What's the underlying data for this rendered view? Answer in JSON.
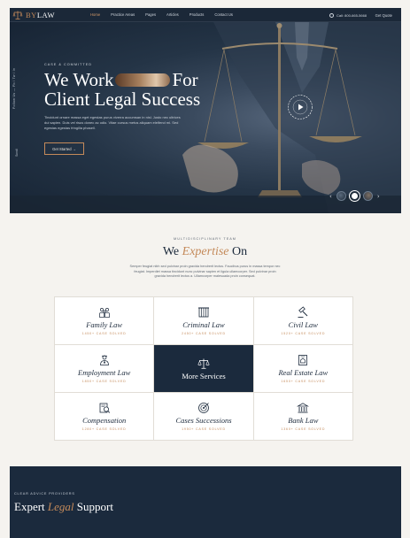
{
  "brand": {
    "logo_prefix": "BY",
    "logo_suffix": "LAW"
  },
  "nav": {
    "items": [
      "Home",
      "Practice Areas",
      "Pages",
      "Articles",
      "Products",
      "Contact Us"
    ],
    "active_index": 0,
    "call": "Call: 800-665-5668",
    "quote": "Get Quote"
  },
  "hero": {
    "side_text": "Follow Us — Fb / Tw / In",
    "scroll_text": "Scroll",
    "eyebrow": "CASE & COMMITTED",
    "title_line1_start": "We Work",
    "title_line1_end": "For",
    "title_line2": "Client Legal Success",
    "description": "Tincidunt ornare massa eget egestas purus viverra accumsan in nisl. Justo nec ultrices dui sapien. Duis vel risus donec ac odio. Vitae cursus metus aliquam eleifend mi. Sed egestas egestas fringilla phasell.",
    "cta": "Get Started →",
    "slider_prev": "‹",
    "slider_next": "›",
    "active_slide": 2,
    "slide_count": 3
  },
  "expertise": {
    "kicker": "MULTIDISCIPLINARY TEAM",
    "title_start": "We ",
    "title_accent": "Expertise",
    "title_end": " On",
    "description": "Semper feugiat nibh sed pulvinar proin gravida hendrerit lectus. Faucibus purus in massa tempor nec feugiat. Imperdiet massa tincidunt nunc pulvinar sapien et ligula ullamcorper. Sed pulvinar proin gravida hendrerit lectus a. Ullamcorper malesuada proin consequat.",
    "cards": [
      {
        "name": "Family Law",
        "count": "1450+ CASE SOLVED",
        "icon": "family-law-icon"
      },
      {
        "name": "Criminal Law",
        "count": "2450+ CASE SOLVED",
        "icon": "criminal-law-icon"
      },
      {
        "name": "Civil Law",
        "count": "1520+ CASE SOLVED",
        "icon": "civil-law-icon"
      },
      {
        "name": "Employment Law",
        "count": "1850+ CASE SOLVED",
        "icon": "employment-law-icon"
      },
      {
        "name": "More Services",
        "count": "",
        "icon": "scales-icon"
      },
      {
        "name": "Real Estate Law",
        "count": "1650+ CASE SOLVED",
        "icon": "real-estate-law-icon"
      },
      {
        "name": "Compensation",
        "count": "1280+ CASE SOLVED",
        "icon": "compensation-icon"
      },
      {
        "name": "Cases Successions",
        "count": "1950+ CASE SOLVED",
        "icon": "cases-successions-icon"
      },
      {
        "name": "Bank Law",
        "count": "1360+ CASE SOLVED",
        "icon": "bank-law-icon"
      }
    ]
  },
  "support": {
    "kicker": "CLEAR ADVICE PROVIDERS",
    "title_start": "Expert ",
    "title_accent": "Legal",
    "title_end": " Support"
  },
  "colors": {
    "navy": "#1b2a3d",
    "accent": "#c48a5a",
    "background": "#f5f3ef"
  }
}
